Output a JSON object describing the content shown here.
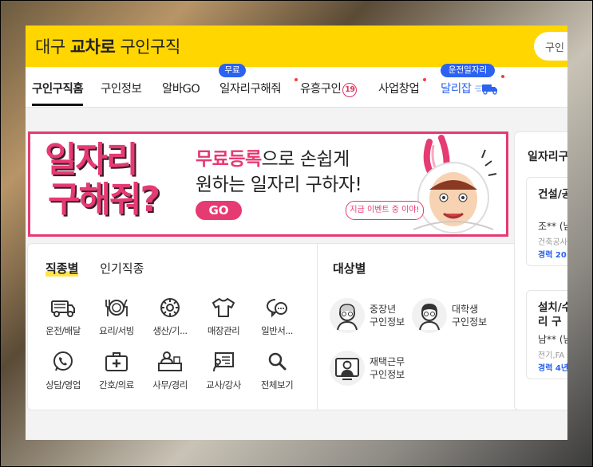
{
  "header": {
    "brand_prefix": "대구",
    "brand_bold": "교차로",
    "brand_suffix": "구인구직",
    "search_placeholder": "구인",
    "bg_color": "#ffd600"
  },
  "nav": {
    "items": [
      {
        "label": "구인구직홈"
      },
      {
        "label": "구인정보"
      },
      {
        "label": "알바GO"
      },
      {
        "label": "일자리구해줘",
        "tag": "무료"
      },
      {
        "label": "유흥구인",
        "badge": "19"
      },
      {
        "label": "사업창업"
      },
      {
        "label": "달리잡",
        "tag": "운전일자리"
      }
    ]
  },
  "banner": {
    "big_line1": "일자리",
    "big_line2": "구해줘?",
    "line1_highlight": "무료등록",
    "line1_rest": "으로 손쉽게",
    "line2": "원하는 일자리 구하자!",
    "go_label": "GO",
    "bubble": "지금 이벤트 중 이야!",
    "accent_color": "#e63a72"
  },
  "categories": {
    "tabs": [
      {
        "label": "직종별"
      },
      {
        "label": "인기직종"
      }
    ],
    "items": [
      {
        "label": "운전/배달",
        "icon": "truck-icon"
      },
      {
        "label": "요리/서빙",
        "icon": "dining-icon"
      },
      {
        "label": "생산/기...",
        "icon": "gear-icon"
      },
      {
        "label": "매장관리",
        "icon": "shirt-icon"
      },
      {
        "label": "일반서...",
        "icon": "chat-icon"
      },
      {
        "label": "상담/영업",
        "icon": "phone-chat-icon"
      },
      {
        "label": "간호/의료",
        "icon": "medical-kit-icon"
      },
      {
        "label": "사무/경리",
        "icon": "office-worker-icon"
      },
      {
        "label": "교사/강사",
        "icon": "teacher-board-icon"
      },
      {
        "label": "전체보기",
        "icon": "search-icon"
      }
    ]
  },
  "targets": {
    "title": "대상별",
    "items": [
      {
        "line1": "중장년",
        "line2": "구인정보"
      },
      {
        "line1": "대학생",
        "line2": "구인정보"
      },
      {
        "line1": "재택근무",
        "line2": "구인정보"
      }
    ]
  },
  "side": {
    "title": "일자리구",
    "jobs": [
      {
        "title": "건설/공 요",
        "name": "조** (남",
        "category": "건축공사",
        "exp": "경력 20"
      },
      {
        "title": "설치/수 자리 구",
        "name": "남** (남",
        "category": "전기,FA",
        "exp": "경력 4년"
      }
    ]
  }
}
